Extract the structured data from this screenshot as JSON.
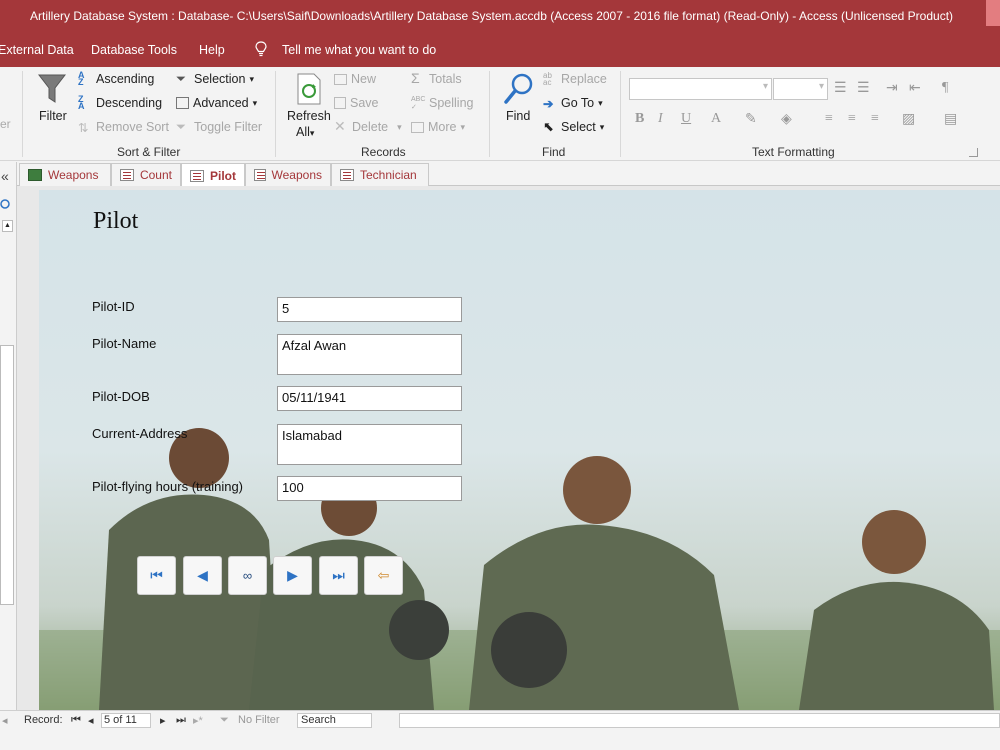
{
  "window": {
    "title": "Artillery Database System : Database- C:\\Users\\Saif\\Downloads\\Artillery Database System.accdb (Access 2007 - 2016 file format) (Read-Only)  -  Access (Unlicensed Product)",
    "accent_color": "#a4373a"
  },
  "ribbon_tabs": {
    "external_data": "External Data",
    "database_tools": "Database Tools",
    "help": "Help",
    "tell_me": "Tell me what you want to do"
  },
  "sort_filter": {
    "filter": "Filter",
    "ascending": "Ascending",
    "descending": "Descending",
    "remove_sort": "Remove Sort",
    "selection": "Selection",
    "advanced": "Advanced",
    "toggle_filter": "Toggle Filter",
    "group_label": "Sort & Filter"
  },
  "records": {
    "refresh": "Refresh",
    "all": "All",
    "new": "New",
    "save": "Save",
    "delete": "Delete",
    "totals": "Totals",
    "spelling": "Spelling",
    "more": "More",
    "group_label": "Records"
  },
  "find": {
    "find": "Find",
    "replace": "Replace",
    "go_to": "Go To",
    "select": "Select",
    "group_label": "Find"
  },
  "text_formatting": {
    "bold": "B",
    "italic": "I",
    "underline": "U",
    "font_color": "A",
    "group_label": "Text Formatting"
  },
  "doc_tabs": [
    {
      "label": "Weapons",
      "icon": "datasheet-icon"
    },
    {
      "label": "Count",
      "icon": "form-icon"
    },
    {
      "label": "Pilot",
      "icon": "form-icon"
    },
    {
      "label": "Weapons",
      "icon": "form-icon"
    },
    {
      "label": "Technician",
      "icon": "form-icon"
    }
  ],
  "form": {
    "title": "Pilot",
    "fields": [
      {
        "label": "Pilot-ID",
        "value": "5"
      },
      {
        "label": "Pilot-Name",
        "value": "Afzal Awan"
      },
      {
        "label": "Pilot-DOB",
        "value": "05/11/1941"
      },
      {
        "label": "Current-Address",
        "value": "Islamabad"
      },
      {
        "label": "Pilot-flying hours (training)",
        "value": "100"
      }
    ]
  },
  "record_nav": {
    "label": "Record:",
    "current": "5 of 11",
    "no_filter": "No Filter",
    "search": "Search"
  }
}
